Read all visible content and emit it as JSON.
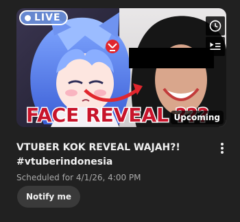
{
  "thumbnail": {
    "live_label": "LIVE",
    "overlay_text": "FACE REVEAL ???",
    "status_badge": "Upcoming",
    "actions": [
      {
        "icon": "clock-icon"
      },
      {
        "icon": "add-to-queue-icon"
      }
    ]
  },
  "video": {
    "title": "VTUBER KOK REVEAL WAJAH?!\n#vtuberindonesia",
    "scheduled": "Scheduled for 4/1/26, 4:00 PM",
    "more_icon": "more-vertical-icon"
  },
  "notify": {
    "label": "Notify me"
  },
  "colors": {
    "background": "#212121",
    "button": "#3a3a3a",
    "overlay_text": "#c8142b",
    "live_badge": "#6e96e6"
  }
}
